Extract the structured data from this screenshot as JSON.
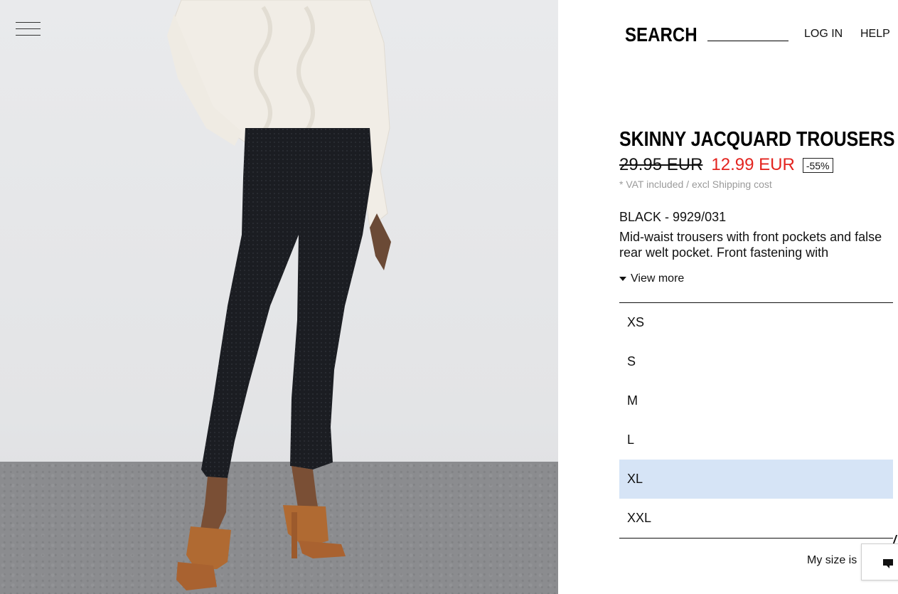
{
  "header": {
    "search_label": "SEARCH",
    "search_placeholder": "",
    "login_label": "LOG IN",
    "help_label": "HELP"
  },
  "product": {
    "title": "SKINNY JACQUARD TROUSERS",
    "old_price": "29.95 EUR",
    "new_price": "12.99 EUR",
    "discount": "-55%",
    "vat_note": "* VAT included / excl Shipping cost",
    "color_ref": "BLACK - 9929/031",
    "description": "Mid-waist trousers with front pockets and false rear welt pocket. Front fastening with",
    "view_more_label": "View more"
  },
  "sizes": [
    {
      "label": "XS",
      "selected": false
    },
    {
      "label": "S",
      "selected": false
    },
    {
      "label": "M",
      "selected": false
    },
    {
      "label": "L",
      "selected": false
    },
    {
      "label": "XL",
      "selected": true
    },
    {
      "label": "XXL",
      "selected": false
    }
  ],
  "my_size_label": "My size is",
  "colors": {
    "sale_red": "#e3241f",
    "selected_size_bg": "#d6e4f6",
    "vat_gray": "#9a9a9a"
  },
  "icons": {
    "menu": "hamburger-menu-icon",
    "view_more": "caret-down-icon",
    "chat": "chat-icon"
  }
}
